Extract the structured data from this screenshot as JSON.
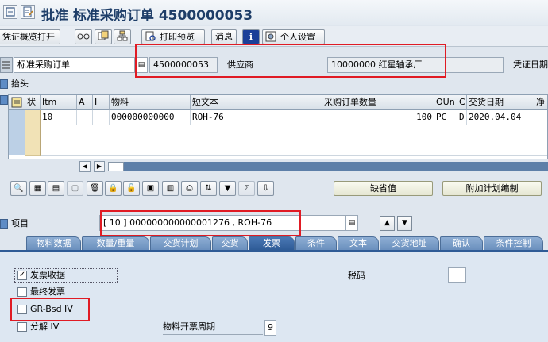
{
  "title": "批准 标准采购订单 4500000053",
  "toolbar": {
    "voucher_overview": "凭证概览打开",
    "print_preview": "打印预览",
    "messages": "消息",
    "personal_settings": "个人设置",
    "info_icon_text": "i"
  },
  "header": {
    "order_type": "标准采购订单",
    "po_number": "4500000053",
    "vendor_label": "供应商",
    "vendor_value": "10000000 红星轴承厂",
    "doc_date_label": "凭证日期"
  },
  "section_head": "抬头",
  "grid": {
    "columns": [
      "状",
      "Itm",
      "A",
      "I",
      "物料",
      "短文本",
      "采购订单数量",
      "OUn",
      "C",
      "交货日期",
      "净"
    ],
    "rows": [
      {
        "itm": "10",
        "a": "",
        "i": "",
        "material": "000000000000",
        "short_text": "ROH-76",
        "qty": "100",
        "oun": "PC",
        "c": "D",
        "date": "2020.04.04"
      }
    ]
  },
  "buttons": {
    "default_values": "缺省值",
    "additional_planning": "附加计划编制"
  },
  "item": {
    "label": "项目",
    "value": "[ 10 ] 000000000000001276 , ROH-76"
  },
  "tabs": [
    "物料数据",
    "数量/重量",
    "交货计划",
    "交货",
    "发票",
    "条件",
    "文本",
    "交货地址",
    "确认",
    "条件控制"
  ],
  "active_tab": "发票",
  "invoice": {
    "invoice_receipt": "发票收据",
    "final_invoice": "最终发票",
    "gr_based_iv": "GR-Bsd IV",
    "split_iv": "分解 IV",
    "tax_code_label": "税码",
    "tax_code_value": "",
    "material_cycle_label": "物料开票周期",
    "material_cycle_value": "9"
  },
  "checks": {
    "invoice_receipt": true,
    "final_invoice": false,
    "gr_based_iv": false,
    "split_iv": false
  },
  "colors": {
    "highlight": "#e01b24",
    "tab": "#6a8fbd",
    "tab_active": "#2e5b96"
  }
}
